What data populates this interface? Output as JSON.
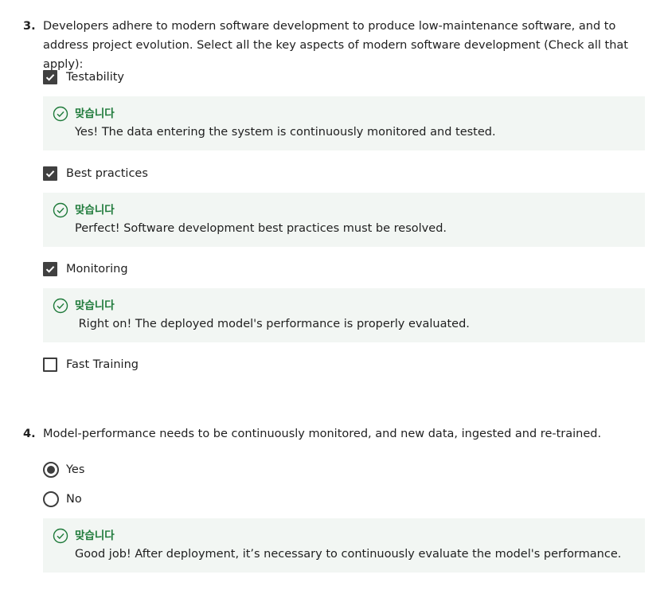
{
  "questions": [
    {
      "number": "3.",
      "prompt": "Developers adhere to modern software development to produce low-maintenance software, and to address project evolution. Select all the key aspects of modern software development (Check all that apply):",
      "type": "checkbox",
      "options": [
        {
          "label": "Testability",
          "checked": true,
          "feedback": {
            "title": "맞습니다",
            "text": "Yes! The data entering the system is continuously monitored and tested."
          }
        },
        {
          "label": "Best practices",
          "checked": true,
          "feedback": {
            "title": "맞습니다",
            "text": "Perfect! Software development best practices must be resolved."
          }
        },
        {
          "label": "Monitoring",
          "checked": true,
          "feedback": {
            "title": "맞습니다",
            "text": " Right on! The deployed model's performance is properly evaluated."
          }
        },
        {
          "label": "Fast Training",
          "checked": false
        }
      ]
    },
    {
      "number": "4.",
      "prompt": "Model-performance needs to be continuously monitored, and new data, ingested and re-trained.",
      "type": "radio",
      "options": [
        {
          "label": "Yes",
          "selected": true
        },
        {
          "label": "No",
          "selected": false
        }
      ],
      "feedback": {
        "title": "맞습니다",
        "text": "Good job! After deployment, it’s necessary to continuously evaluate the model's performance."
      }
    }
  ],
  "colors": {
    "feedback_bg": "#f2f6f3",
    "correct_green": "#1e7a3a",
    "control_dark": "#404040"
  },
  "icons": {
    "correct": "check-circle-icon",
    "checked": "checkmark-icon"
  }
}
